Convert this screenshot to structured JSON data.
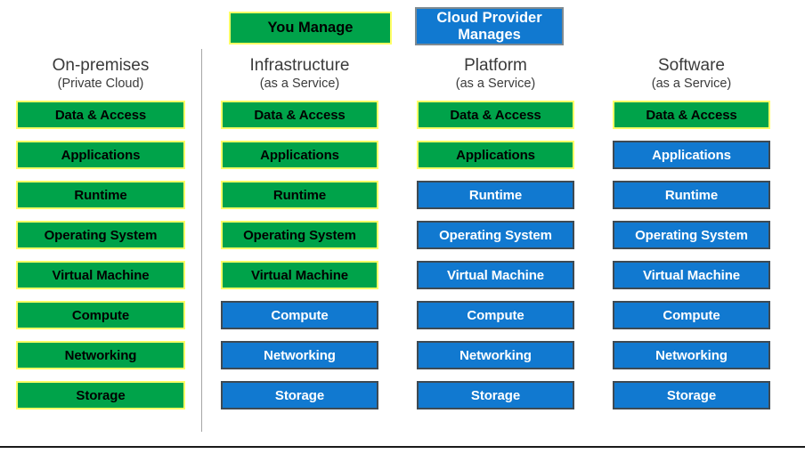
{
  "legend": {
    "you_manage": "You Manage",
    "provider_manages": "Cloud Provider Manages",
    "you_manage_color": "#00a34a",
    "provider_manages_color": "#1179d0",
    "you_manage_border_color": "#ffff66",
    "provider_manages_border_color": "#7e8a91"
  },
  "colors": {
    "green_fill": "#00a34a",
    "green_border": "#ffff66",
    "green_text": "#000000",
    "blue_fill": "#1179d0",
    "blue_border": "#3f4a52",
    "blue_text": "#ffffff",
    "header_text": "#3b3b3b",
    "separator": "#a6a6a6",
    "bottom_rule": "#1a1a1a",
    "background": "#ffffff"
  },
  "layer_names": [
    "Data & Access",
    "Applications",
    "Runtime",
    "Operating System",
    "Virtual Machine",
    "Compute",
    "Networking",
    "Storage"
  ],
  "columns": [
    {
      "title": "On-premises",
      "subtitle": "(Private Cloud)",
      "layers": [
        {
          "label": "Data & Access",
          "managed_by": "you"
        },
        {
          "label": "Applications",
          "managed_by": "you"
        },
        {
          "label": "Runtime",
          "managed_by": "you"
        },
        {
          "label": "Operating System",
          "managed_by": "you"
        },
        {
          "label": "Virtual Machine",
          "managed_by": "you"
        },
        {
          "label": "Compute",
          "managed_by": "you"
        },
        {
          "label": "Networking",
          "managed_by": "you"
        },
        {
          "label": "Storage",
          "managed_by": "you"
        }
      ]
    },
    {
      "title": "Infrastructure",
      "subtitle": "(as a Service)",
      "layers": [
        {
          "label": "Data & Access",
          "managed_by": "you"
        },
        {
          "label": "Applications",
          "managed_by": "you"
        },
        {
          "label": "Runtime",
          "managed_by": "you"
        },
        {
          "label": "Operating System",
          "managed_by": "you"
        },
        {
          "label": "Virtual Machine",
          "managed_by": "you"
        },
        {
          "label": "Compute",
          "managed_by": "provider"
        },
        {
          "label": "Networking",
          "managed_by": "provider"
        },
        {
          "label": "Storage",
          "managed_by": "provider"
        }
      ]
    },
    {
      "title": "Platform",
      "subtitle": "(as a Service)",
      "layers": [
        {
          "label": "Data & Access",
          "managed_by": "you"
        },
        {
          "label": "Applications",
          "managed_by": "you"
        },
        {
          "label": "Runtime",
          "managed_by": "provider"
        },
        {
          "label": "Operating System",
          "managed_by": "provider"
        },
        {
          "label": "Virtual Machine",
          "managed_by": "provider"
        },
        {
          "label": "Compute",
          "managed_by": "provider"
        },
        {
          "label": "Networking",
          "managed_by": "provider"
        },
        {
          "label": "Storage",
          "managed_by": "provider"
        }
      ]
    },
    {
      "title": "Software",
      "subtitle": "(as a Service)",
      "layers": [
        {
          "label": "Data & Access",
          "managed_by": "you"
        },
        {
          "label": "Applications",
          "managed_by": "provider"
        },
        {
          "label": "Runtime",
          "managed_by": "provider"
        },
        {
          "label": "Operating System",
          "managed_by": "provider"
        },
        {
          "label": "Virtual Machine",
          "managed_by": "provider"
        },
        {
          "label": "Compute",
          "managed_by": "provider"
        },
        {
          "label": "Networking",
          "managed_by": "provider"
        },
        {
          "label": "Storage",
          "managed_by": "provider"
        }
      ]
    }
  ]
}
